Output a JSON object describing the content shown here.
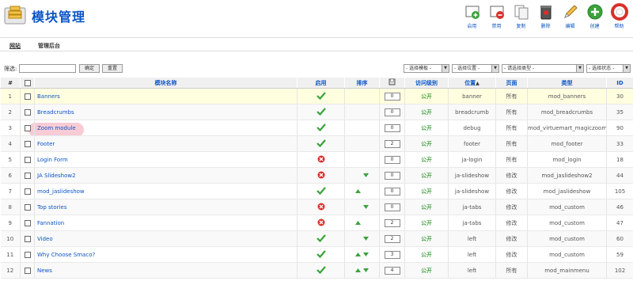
{
  "header": {
    "title": "模块管理",
    "toolbar": [
      {
        "label": "启用",
        "icon": "publish-icon"
      },
      {
        "label": "禁用",
        "icon": "unpublish-icon"
      },
      {
        "label": "复制",
        "icon": "copy-icon"
      },
      {
        "label": "删除",
        "icon": "trash-icon"
      },
      {
        "label": "编辑",
        "icon": "edit-icon"
      },
      {
        "label": "创建",
        "icon": "new-icon"
      },
      {
        "label": "帮助",
        "icon": "help-icon"
      }
    ]
  },
  "submenu": {
    "site": "网站",
    "admin": "管理后台"
  },
  "filter": {
    "label": "筛选:",
    "input_value": "",
    "go_label": "确定",
    "reset_label": "重置",
    "selects": [
      "- 选择模板 -",
      "- 选择位置 -",
      "- 请选择类型 -",
      "- 选择状态 -"
    ]
  },
  "columns": {
    "num": "#",
    "name": "模块名称",
    "enabled": "启用",
    "order": "排序",
    "access": "访问级别",
    "position": "位置",
    "pages": "页面",
    "type": "类型",
    "id": "ID"
  },
  "rows": [
    {
      "num": "1",
      "name": "Banners",
      "status": "on",
      "up": false,
      "down": false,
      "order": "0",
      "access": "公开",
      "position": "banner",
      "pages": "所有",
      "type": "mod_banners",
      "id": "30"
    },
    {
      "num": "2",
      "name": "Breadcrumbs",
      "status": "on",
      "up": false,
      "down": false,
      "order": "0",
      "access": "公开",
      "position": "breadcrumb",
      "pages": "所有",
      "type": "mod_breadcrumbs",
      "id": "35"
    },
    {
      "num": "3",
      "name": "Zoom module",
      "status": "on",
      "up": false,
      "down": false,
      "order": "0",
      "access": "公开",
      "position": "debug",
      "pages": "所有",
      "type": "mod_virtuemart_magiczoom",
      "id": "90"
    },
    {
      "num": "4",
      "name": "Footer",
      "status": "on",
      "up": false,
      "down": false,
      "order": "2",
      "access": "公开",
      "position": "footer",
      "pages": "所有",
      "type": "mod_footer",
      "id": "33"
    },
    {
      "num": "5",
      "name": "Login Form",
      "status": "off",
      "up": false,
      "down": false,
      "order": "0",
      "access": "公开",
      "position": "ja-login",
      "pages": "所有",
      "type": "mod_login",
      "id": "18"
    },
    {
      "num": "6",
      "name": "JA Slideshow2",
      "status": "off",
      "up": false,
      "down": true,
      "order": "0",
      "access": "公开",
      "position": "ja-slideshow",
      "pages": "修改",
      "type": "mod_jaslideshow2",
      "id": "44"
    },
    {
      "num": "7",
      "name": "mod_jaslideshow",
      "status": "on",
      "up": true,
      "down": false,
      "order": "0",
      "access": "公开",
      "position": "ja-slideshow",
      "pages": "修改",
      "type": "mod_jaslideshow",
      "id": "105"
    },
    {
      "num": "8",
      "name": "Top stories",
      "status": "off",
      "up": false,
      "down": true,
      "order": "0",
      "access": "公开",
      "position": "ja-tabs",
      "pages": "修改",
      "type": "mod_custom",
      "id": "46"
    },
    {
      "num": "9",
      "name": "Fannation",
      "status": "off",
      "up": true,
      "down": false,
      "order": "2",
      "access": "公开",
      "position": "ja-tabs",
      "pages": "修改",
      "type": "mod_custom",
      "id": "47"
    },
    {
      "num": "10",
      "name": "Video",
      "status": "on",
      "up": false,
      "down": true,
      "order": "2",
      "access": "公开",
      "position": "left",
      "pages": "修改",
      "type": "mod_custom",
      "id": "60"
    },
    {
      "num": "11",
      "name": "Why Choose Smaco?",
      "status": "on",
      "up": true,
      "down": true,
      "order": "3",
      "access": "公开",
      "position": "left",
      "pages": "修改",
      "type": "mod_custom",
      "id": "59"
    },
    {
      "num": "12",
      "name": "News",
      "status": "on",
      "up": true,
      "down": true,
      "order": "4",
      "access": "公开",
      "position": "left",
      "pages": "所有",
      "type": "mod_mainmenu",
      "id": "102"
    }
  ]
}
